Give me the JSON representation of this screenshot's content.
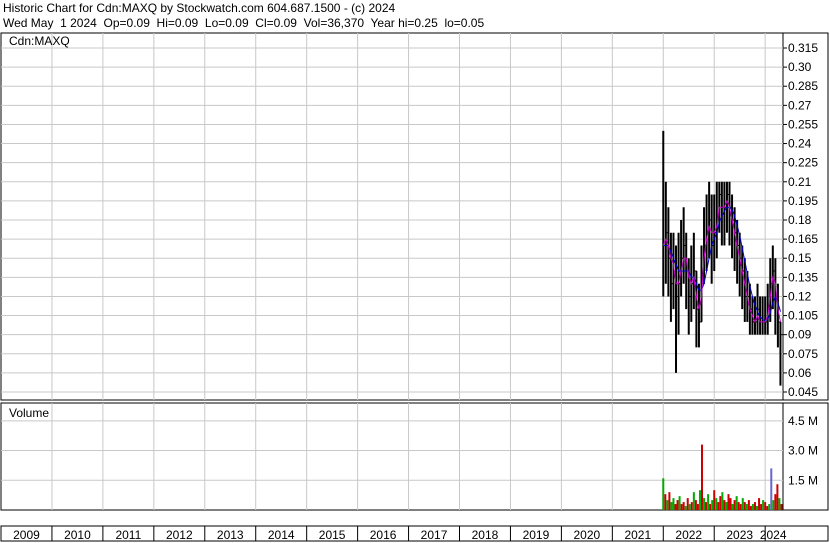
{
  "header": {
    "line1": "Historic Chart for Cdn:MAXQ by Stockwatch.com 604.687.1500 - (c) 2024",
    "line2": "Wed May  1 2024  Op=0.09  Hi=0.09  Lo=0.09  Cl=0.09  Vol=36,370  Year hi=0.25  lo=0.05"
  },
  "chart_data": [
    {
      "type": "line",
      "title": "Cdn:MAXQ",
      "series": [
        {
          "values_note": "",
          "color": "#000000"
        },
        {
          "color": "#cc00cc"
        },
        {
          "color": "#0000cc"
        }
      ],
      "x": [
        2022.0,
        2022.05,
        2022.1,
        2022.15,
        2022.2,
        2022.25,
        2022.3,
        2022.35,
        2022.4,
        2022.45,
        2022.5,
        2022.55,
        2022.6,
        2022.65,
        2022.7,
        2022.75,
        2022.8,
        2022.85,
        2022.9,
        2022.95,
        2023.0,
        2023.05,
        2023.1,
        2023.15,
        2023.2,
        2023.25,
        2023.3,
        2023.35,
        2023.4,
        2023.45,
        2023.5,
        2023.55,
        2023.6,
        2023.65,
        2023.7,
        2023.75,
        2023.8,
        2023.85,
        2023.9,
        2023.95,
        2024.0,
        2024.05,
        2024.1,
        2024.15,
        2024.2,
        2024.25,
        2024.3
      ],
      "close": [
        0.16,
        0.17,
        0.15,
        0.13,
        0.14,
        0.12,
        0.13,
        0.15,
        0.16,
        0.14,
        0.12,
        0.13,
        0.14,
        0.11,
        0.1,
        0.13,
        0.16,
        0.17,
        0.18,
        0.16,
        0.17,
        0.18,
        0.2,
        0.19,
        0.19,
        0.2,
        0.19,
        0.18,
        0.17,
        0.16,
        0.15,
        0.14,
        0.12,
        0.12,
        0.11,
        0.1,
        0.1,
        0.11,
        0.1,
        0.1,
        0.1,
        0.11,
        0.13,
        0.14,
        0.12,
        0.1,
        0.09
      ],
      "high": [
        0.25,
        0.21,
        0.19,
        0.17,
        0.17,
        0.16,
        0.17,
        0.18,
        0.19,
        0.17,
        0.15,
        0.16,
        0.17,
        0.14,
        0.13,
        0.16,
        0.19,
        0.2,
        0.21,
        0.2,
        0.2,
        0.21,
        0.21,
        0.21,
        0.21,
        0.21,
        0.21,
        0.2,
        0.19,
        0.18,
        0.17,
        0.16,
        0.15,
        0.14,
        0.13,
        0.12,
        0.12,
        0.13,
        0.12,
        0.12,
        0.12,
        0.13,
        0.15,
        0.16,
        0.15,
        0.13,
        0.1
      ],
      "low": [
        0.12,
        0.13,
        0.12,
        0.1,
        0.11,
        0.06,
        0.09,
        0.12,
        0.13,
        0.11,
        0.09,
        0.1,
        0.11,
        0.08,
        0.08,
        0.1,
        0.13,
        0.14,
        0.15,
        0.13,
        0.14,
        0.15,
        0.17,
        0.16,
        0.16,
        0.17,
        0.16,
        0.15,
        0.14,
        0.13,
        0.12,
        0.11,
        0.1,
        0.1,
        0.09,
        0.09,
        0.09,
        0.09,
        0.09,
        0.09,
        0.09,
        0.09,
        0.1,
        0.11,
        0.09,
        0.08,
        0.05
      ],
      "ma_short": [
        0.16,
        0.165,
        0.16,
        0.15,
        0.145,
        0.13,
        0.13,
        0.14,
        0.15,
        0.15,
        0.135,
        0.13,
        0.135,
        0.12,
        0.11,
        0.12,
        0.15,
        0.165,
        0.175,
        0.17,
        0.17,
        0.175,
        0.19,
        0.19,
        0.19,
        0.195,
        0.19,
        0.18,
        0.17,
        0.16,
        0.15,
        0.14,
        0.13,
        0.12,
        0.11,
        0.105,
        0.1,
        0.105,
        0.1,
        0.1,
        0.1,
        0.105,
        0.12,
        0.135,
        0.13,
        0.11,
        0.1
      ],
      "ma_long": [
        0.16,
        0.16,
        0.16,
        0.155,
        0.15,
        0.145,
        0.14,
        0.14,
        0.14,
        0.14,
        0.14,
        0.135,
        0.135,
        0.13,
        0.125,
        0.125,
        0.13,
        0.14,
        0.15,
        0.16,
        0.165,
        0.17,
        0.178,
        0.183,
        0.187,
        0.19,
        0.19,
        0.188,
        0.183,
        0.176,
        0.168,
        0.158,
        0.148,
        0.138,
        0.128,
        0.12,
        0.113,
        0.108,
        0.104,
        0.102,
        0.101,
        0.102,
        0.107,
        0.115,
        0.12,
        0.115,
        0.108
      ],
      "y_ticks": [
        "0.315",
        "0.30",
        "0.285",
        "0.27",
        "0.255",
        "0.24",
        "0.225",
        "0.21",
        "0.195",
        "0.18",
        "0.165",
        "0.15",
        "0.135",
        "0.12",
        "0.105",
        "0.09",
        "0.075",
        "0.06",
        "0.045"
      ],
      "ylim": [
        0.045,
        0.315
      ],
      "grid": true
    },
    {
      "type": "bar",
      "title": "Volume",
      "y_ticks": [
        "4.5 M",
        "3.0 M",
        "1.5 M"
      ],
      "ylim": [
        0,
        5.4
      ],
      "x": [
        2022.0,
        2022.04,
        2022.08,
        2022.12,
        2022.16,
        2022.2,
        2022.24,
        2022.28,
        2022.32,
        2022.36,
        2022.4,
        2022.44,
        2022.48,
        2022.52,
        2022.56,
        2022.6,
        2022.64,
        2022.68,
        2022.72,
        2022.76,
        2022.8,
        2022.84,
        2022.88,
        2022.92,
        2022.96,
        2023.0,
        2023.04,
        2023.08,
        2023.12,
        2023.16,
        2023.2,
        2023.24,
        2023.28,
        2023.32,
        2023.36,
        2023.4,
        2023.44,
        2023.48,
        2023.52,
        2023.56,
        2023.6,
        2023.64,
        2023.68,
        2023.72,
        2023.76,
        2023.8,
        2023.84,
        2023.88,
        2023.92,
        2023.96,
        2024.0,
        2024.04,
        2024.08,
        2024.12,
        2024.16,
        2024.2,
        2024.24,
        2024.28,
        2024.32
      ],
      "values": [
        1.6,
        0.8,
        0.5,
        0.9,
        0.4,
        0.6,
        0.3,
        0.5,
        0.7,
        0.3,
        0.4,
        0.2,
        0.6,
        0.3,
        0.4,
        0.9,
        0.5,
        0.3,
        1.0,
        3.3,
        0.6,
        0.4,
        0.8,
        0.3,
        0.5,
        1.0,
        0.6,
        0.4,
        0.7,
        0.9,
        0.5,
        0.4,
        0.8,
        0.6,
        0.3,
        0.5,
        0.7,
        0.4,
        0.3,
        0.6,
        0.4,
        0.3,
        0.5,
        0.2,
        0.3,
        0.4,
        0.2,
        0.6,
        0.3,
        0.5,
        0.4,
        0.2,
        0.3,
        2.1,
        0.5,
        0.8,
        1.3,
        0.6,
        0.3
      ],
      "colors": [
        "g",
        "r",
        "g",
        "r",
        "g",
        "g",
        "r",
        "r",
        "g",
        "r",
        "r",
        "g",
        "r",
        "g",
        "r",
        "g",
        "r",
        "r",
        "g",
        "r",
        "g",
        "r",
        "g",
        "r",
        "g",
        "r",
        "g",
        "r",
        "r",
        "g",
        "r",
        "g",
        "r",
        "r",
        "g",
        "r",
        "g",
        "r",
        "r",
        "g",
        "r",
        "g",
        "r",
        "r",
        "g",
        "r",
        "g",
        "r",
        "r",
        "g",
        "r",
        "r",
        "g",
        "b",
        "g",
        "r",
        "r",
        "g",
        "r"
      ],
      "grid": true
    }
  ],
  "x_axis": {
    "labels": [
      "2009",
      "2010",
      "2011",
      "2012",
      "2013",
      "2014",
      "2015",
      "2016",
      "2017",
      "2018",
      "2019",
      "2020",
      "2021",
      "2022",
      "2023",
      "2024"
    ],
    "start": 2009.0,
    "end": 2024.35
  }
}
